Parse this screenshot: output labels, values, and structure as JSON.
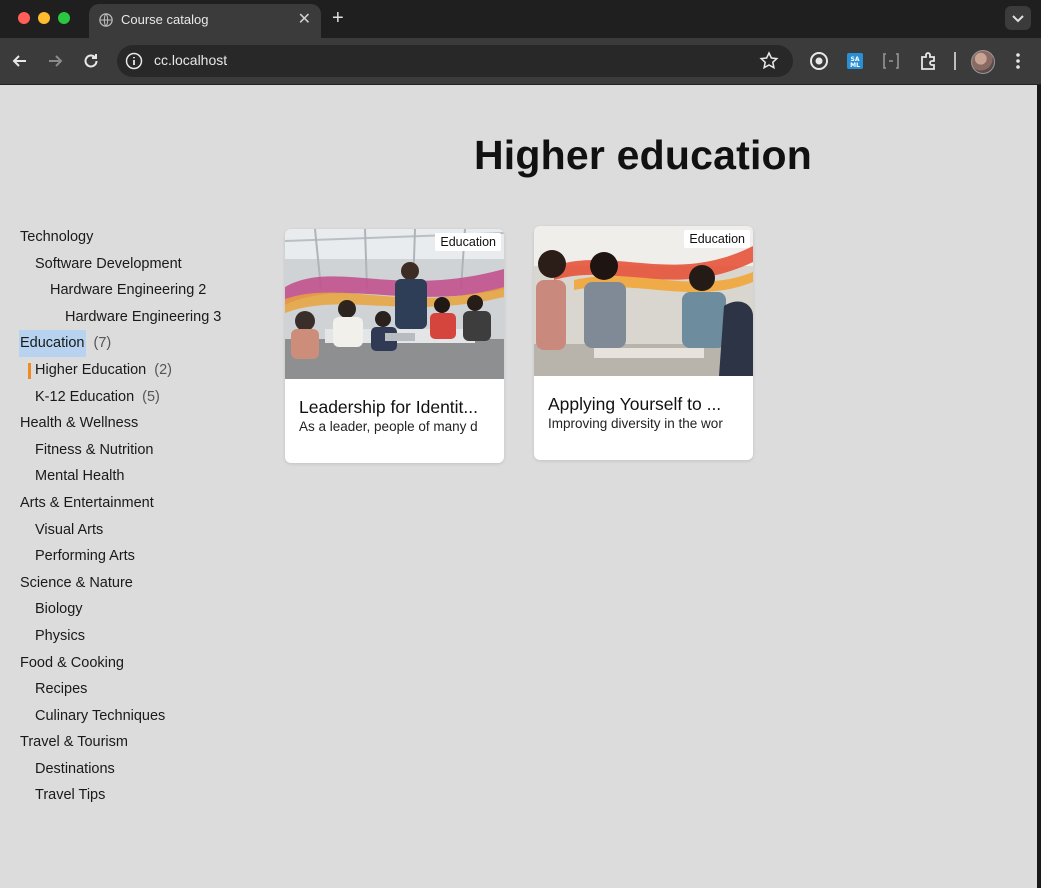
{
  "browser": {
    "tab_title": "Course catalog",
    "url": "cc.localhost"
  },
  "page": {
    "title": "Higher education"
  },
  "sidebar": {
    "items": [
      {
        "label": "Technology",
        "level": 1,
        "count": ""
      },
      {
        "label": "Software Development",
        "level": 2,
        "count": ""
      },
      {
        "label": "Hardware Engineering 2",
        "level": 3,
        "count": ""
      },
      {
        "label": "Hardware Engineering 3",
        "level": 4,
        "count": ""
      },
      {
        "label": "Education",
        "level": 1,
        "count": "(7)",
        "selected": true
      },
      {
        "label": "Higher Education",
        "level": 2,
        "count": "(2)",
        "active": true
      },
      {
        "label": "K-12 Education",
        "level": 2,
        "count": "(5)"
      },
      {
        "label": "Health & Wellness",
        "level": 1,
        "count": ""
      },
      {
        "label": "Fitness & Nutrition",
        "level": 2,
        "count": ""
      },
      {
        "label": "Mental Health",
        "level": 2,
        "count": ""
      },
      {
        "label": "Arts & Entertainment",
        "level": 1,
        "count": ""
      },
      {
        "label": "Visual Arts",
        "level": 2,
        "count": ""
      },
      {
        "label": "Performing Arts",
        "level": 2,
        "count": ""
      },
      {
        "label": "Science & Nature",
        "level": 1,
        "count": ""
      },
      {
        "label": "Biology",
        "level": 2,
        "count": ""
      },
      {
        "label": "Physics",
        "level": 2,
        "count": ""
      },
      {
        "label": "Food & Cooking",
        "level": 1,
        "count": ""
      },
      {
        "label": "Recipes",
        "level": 2,
        "count": ""
      },
      {
        "label": "Culinary Techniques",
        "level": 2,
        "count": ""
      },
      {
        "label": "Travel & Tourism",
        "level": 1,
        "count": ""
      },
      {
        "label": "Destinations",
        "level": 2,
        "count": ""
      },
      {
        "label": "Travel Tips",
        "level": 2,
        "count": ""
      }
    ],
    "accent_color": "#f08a24",
    "selection_color": "#b7d3ef"
  },
  "cards": [
    {
      "badge": "Education",
      "title": "Leadership for Identit...",
      "description": "As a leader, people of many d"
    },
    {
      "badge": "Education",
      "title": "Applying Yourself to ...",
      "description": "Improving diversity in the wor"
    }
  ]
}
